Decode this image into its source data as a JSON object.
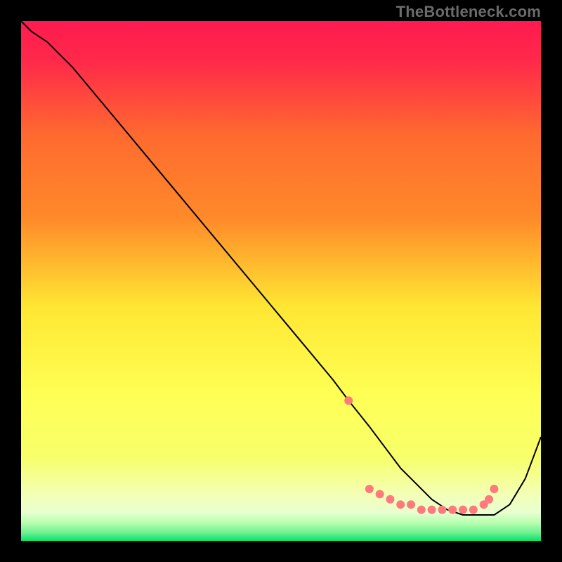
{
  "watermark": "TheBottleneck.com",
  "chart_data": {
    "type": "line",
    "title": "",
    "xlabel": "",
    "ylabel": "",
    "xlim": [
      0,
      100
    ],
    "ylim": [
      0,
      100
    ],
    "grid": false,
    "legend": false,
    "gradient_background": {
      "top_color": "#ff1a4f",
      "upper_mid_color": "#ff8a2a",
      "mid_color": "#ffe733",
      "lower_mid_color": "#f7ff6a",
      "pale_band_color": "#e9ffd0",
      "bottom_color": "#00e36a"
    },
    "series": [
      {
        "name": "bottleneck-curve",
        "color": "#000000",
        "stroke_width": 2,
        "x": [
          0,
          2,
          5,
          10,
          15,
          20,
          25,
          30,
          35,
          40,
          45,
          50,
          55,
          60,
          63,
          67,
          70,
          73,
          76,
          79,
          82,
          85,
          88,
          91,
          94,
          97,
          100
        ],
        "y": [
          100,
          98,
          96,
          91,
          85,
          79,
          73,
          67,
          61,
          55,
          49,
          43,
          37,
          31,
          27,
          22,
          18,
          14,
          11,
          8,
          6,
          5,
          5,
          5,
          7,
          12,
          20
        ]
      }
    ],
    "markers": {
      "name": "highlight-dots",
      "color": "#ff7a7a",
      "radius": 6,
      "x": [
        63,
        67,
        69,
        71,
        73,
        75,
        77,
        79,
        81,
        83,
        85,
        87,
        89,
        90,
        91
      ],
      "y": [
        27,
        10,
        9,
        8,
        7,
        7,
        6,
        6,
        6,
        6,
        6,
        6,
        7,
        8,
        10
      ]
    }
  }
}
